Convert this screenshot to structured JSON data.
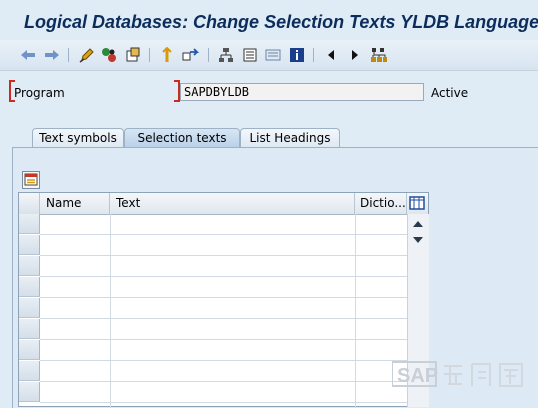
{
  "window": {
    "title": "Logical Databases: Change Selection Texts YLDB  Language"
  },
  "toolbar": {
    "items": [
      "back-arrow-icon",
      "forward-arrow-icon",
      "edit-pencil-icon",
      "activate-icon",
      "object-list-icon",
      "where-used-icon",
      "navigate-icon",
      "hierarchy-icon",
      "display-object-list-icon",
      "overview-icon",
      "info-icon",
      "previous-icon",
      "next-icon",
      "structure-icon"
    ]
  },
  "form": {
    "program_label": "Program",
    "program_value": "SAPDBYLDB",
    "status": "Active"
  },
  "tabs": [
    {
      "label": "Text symbols",
      "active": false
    },
    {
      "label": "Selection texts",
      "active": true
    },
    {
      "label": "List Headings",
      "active": false
    }
  ],
  "table": {
    "columns": [
      "Name",
      "Text",
      "Dictio..."
    ],
    "rows": [
      [
        "",
        "",
        ""
      ],
      [
        "",
        "",
        ""
      ],
      [
        "",
        "",
        ""
      ],
      [
        "",
        "",
        ""
      ],
      [
        "",
        "",
        ""
      ],
      [
        "",
        "",
        ""
      ],
      [
        "",
        "",
        ""
      ],
      [
        "",
        "",
        ""
      ],
      [
        "",
        "",
        ""
      ]
    ]
  },
  "watermark": {
    "text": "SAP"
  },
  "colors": {
    "title": "#0b2d5c",
    "background": "#dfebf5",
    "required": "#cc2a1e"
  }
}
